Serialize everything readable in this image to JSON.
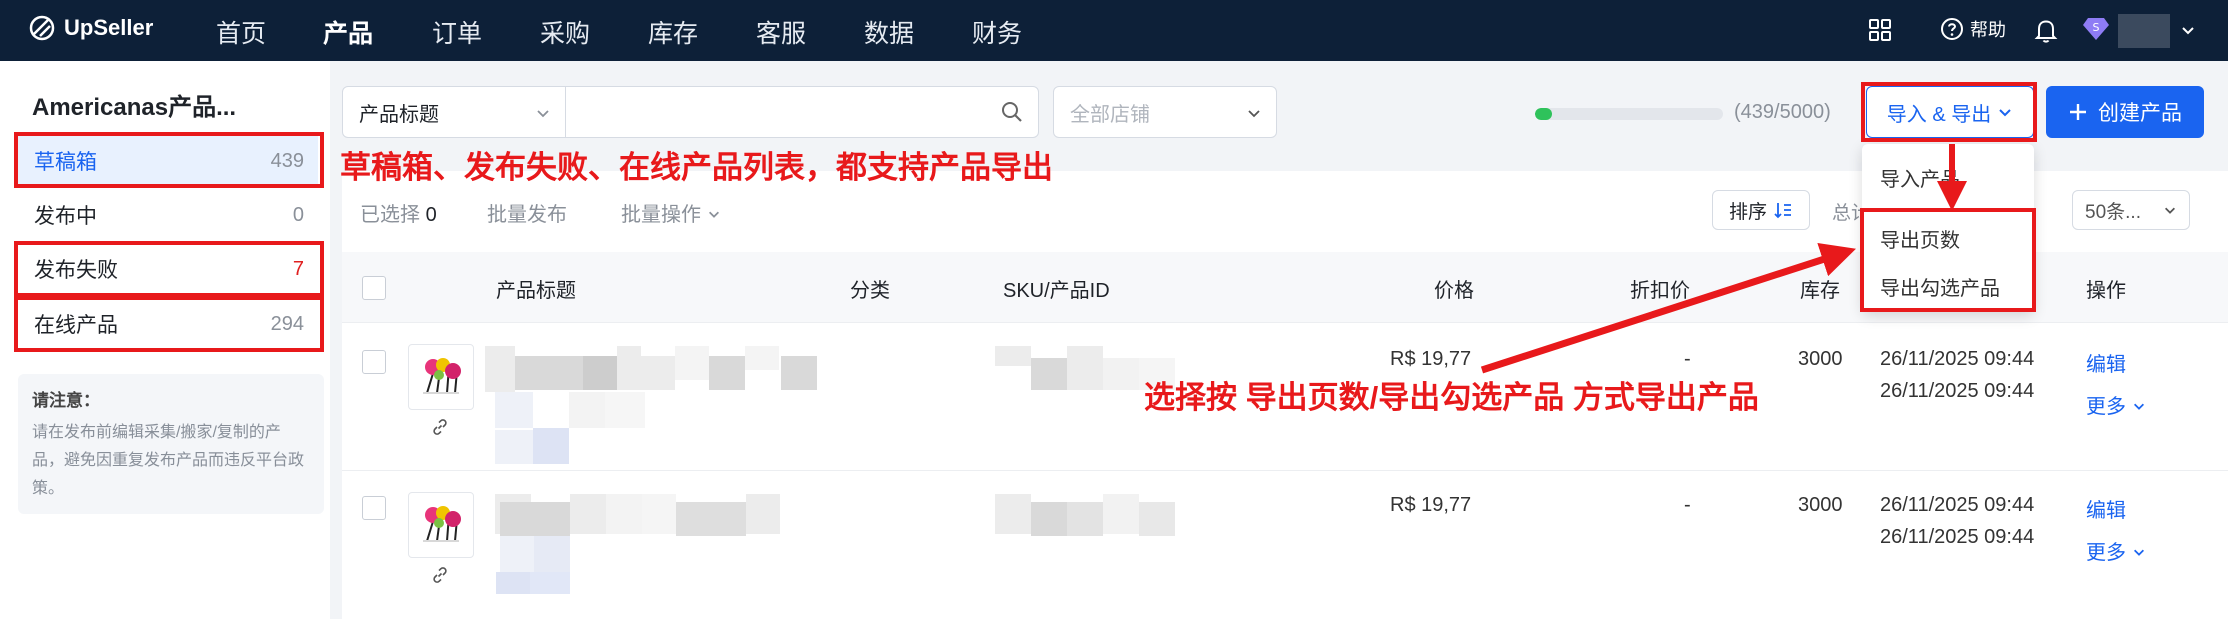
{
  "nav": {
    "logo": "UpSeller",
    "items": [
      "首页",
      "产品",
      "订单",
      "采购",
      "库存",
      "客服",
      "数据",
      "财务"
    ],
    "active_index": 1,
    "help": "帮助"
  },
  "sidebar": {
    "title": "Americanas产品...",
    "items": [
      {
        "label": "草稿箱",
        "count": "439"
      },
      {
        "label": "发布中",
        "count": "0"
      },
      {
        "label": "发布失败",
        "count": "7"
      },
      {
        "label": "在线产品",
        "count": "294"
      }
    ],
    "note_title": "请注意：",
    "note_body": "请在发布前编辑采集/搬家/复制的产品，避免因重复发布产品而违反平台政策。"
  },
  "filters": {
    "field_select": "产品标题",
    "search_value": "",
    "shop_placeholder": "全部店铺"
  },
  "quota": {
    "text": "(439/5000)",
    "fraction": 0.0878
  },
  "actions": {
    "import_export": "导入 & 导出",
    "create": "创建产品"
  },
  "dropdown": [
    "导入产品",
    "导出页数",
    "导出勾选产品"
  ],
  "toolbar": {
    "selected_label": "已选择",
    "selected_count": "0",
    "batch_publish": "批量发布",
    "batch_ops": "批量操作",
    "sort": "排序",
    "total": "总计",
    "page_size": "50条..."
  },
  "columns": [
    "产品标题",
    "分类",
    "SKU/产品ID",
    "价格",
    "折扣价",
    "库存",
    "",
    "操作"
  ],
  "rows": [
    {
      "price": "R$ 19,77",
      "discount": "-",
      "stock": "3000",
      "created": "26/11/2025 09:44",
      "updated": "26/11/2025 09:44",
      "edit": "编辑",
      "more": "更多"
    },
    {
      "price": "R$ 19,77",
      "discount": "-",
      "stock": "3000",
      "created": "26/11/2025 09:44",
      "updated": "26/11/2025 09:44",
      "edit": "编辑",
      "more": "更多"
    }
  ],
  "annotations": {
    "top": "草稿箱、发布失败、在线产品列表，都支持产品导出",
    "middle": "选择按 导出页数/导出勾选产品 方式导出产品"
  },
  "colors": {
    "accent": "#1a64f0",
    "annotation": "#e8191b",
    "nav_bg": "#0d2038",
    "progress": "#2fc25b"
  }
}
